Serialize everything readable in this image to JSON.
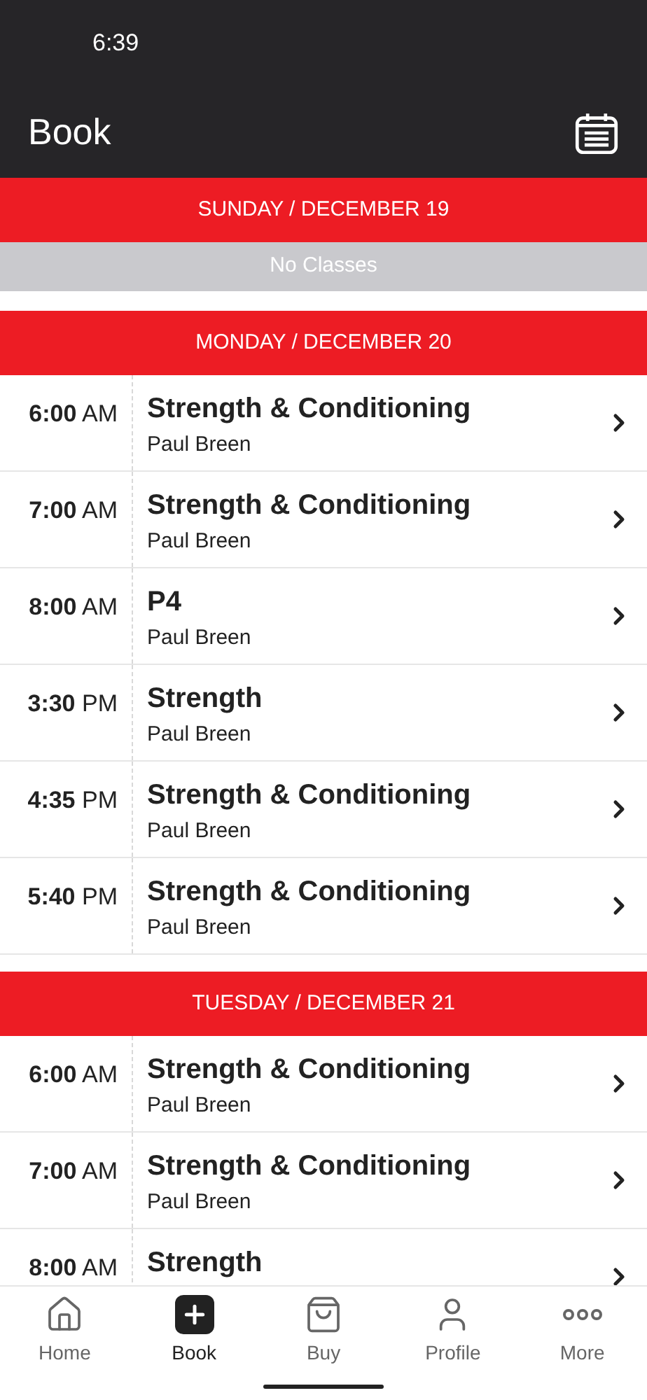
{
  "status_bar": {
    "time": "6:39"
  },
  "header": {
    "title": "Book"
  },
  "days": [
    {
      "label": "SUNDAY / DECEMBER 19",
      "empty_text": "No Classes"
    },
    {
      "label": "MONDAY / DECEMBER 20",
      "classes": [
        {
          "time": "**6:00** AM",
          "title": "Strength & Conditioning",
          "instructor": "Paul Breen"
        },
        {
          "time": "**7:00** AM",
          "title": "Strength & Conditioning",
          "instructor": "Paul Breen"
        },
        {
          "time": "**8:00** AM",
          "title": "P4",
          "instructor": "Paul Breen"
        },
        {
          "time": "**3:30** PM",
          "title": "Strength",
          "instructor": "Paul Breen"
        },
        {
          "time": "**4:35** PM",
          "title": "Strength & Conditioning",
          "instructor": "Paul Breen"
        },
        {
          "time": "**5:40** PM",
          "title": "Strength & Conditioning",
          "instructor": "Paul Breen"
        }
      ]
    },
    {
      "label": "TUESDAY / DECEMBER 21",
      "classes": [
        {
          "time": "**6:00** AM",
          "title": "Strength & Conditioning",
          "instructor": "Paul Breen"
        },
        {
          "time": "**7:00** AM",
          "title": "Strength & Conditioning",
          "instructor": "Paul Breen"
        },
        {
          "time": "**8:00** AM",
          "title": "Strength"
        }
      ]
    }
  ],
  "tab_bar": [
    {
      "kind": "home",
      "label": "Home",
      "selected": false
    },
    {
      "kind": "book",
      "label": "Book",
      "selected": true
    },
    {
      "kind": "buy",
      "label": "Buy",
      "selected": false
    },
    {
      "kind": "profile",
      "label": "Profile",
      "selected": false
    },
    {
      "kind": "more",
      "label": "More",
      "selected": false
    }
  ]
}
